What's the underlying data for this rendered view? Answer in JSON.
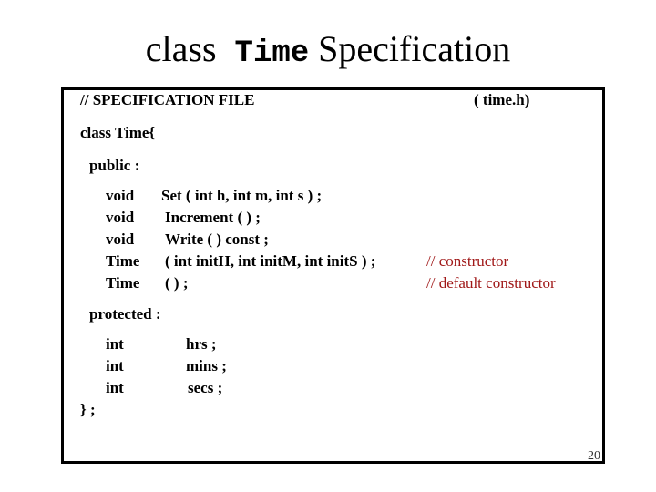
{
  "slide": {
    "title_prefix": "class",
    "title_code": "Time",
    "title_suffix": "Specification",
    "page_number": "20"
  },
  "code": {
    "header_comment": "// SPECIFICATION   FILE",
    "file_name": "( time.h)",
    "class_open": "class  Time{",
    "public_label": "public :",
    "public_members": [
      {
        "type": "void",
        "decl": "Set ( int h, int m, int s ) ;",
        "comment": ""
      },
      {
        "type": "void",
        "decl": "Increment ( ) ;",
        "comment": ""
      },
      {
        "type": "void",
        "decl": "Write ( )  const ;",
        "comment": ""
      },
      {
        "type": "Time",
        "decl": "( int initH, int initM, int initS ) ;",
        "comment": "//  constructor"
      },
      {
        "type": "Time",
        "decl": "( ) ;",
        "comment": "//  default constructor"
      }
    ],
    "protected_label": "protected :",
    "protected_members": [
      {
        "type": "int",
        "name": "hrs ;"
      },
      {
        "type": "int",
        "name": "mins ;"
      },
      {
        "type": "int",
        "name": "secs ;"
      }
    ],
    "class_close": "} ;"
  },
  "colors": {
    "comment": "#a01818",
    "border": "#000000"
  }
}
